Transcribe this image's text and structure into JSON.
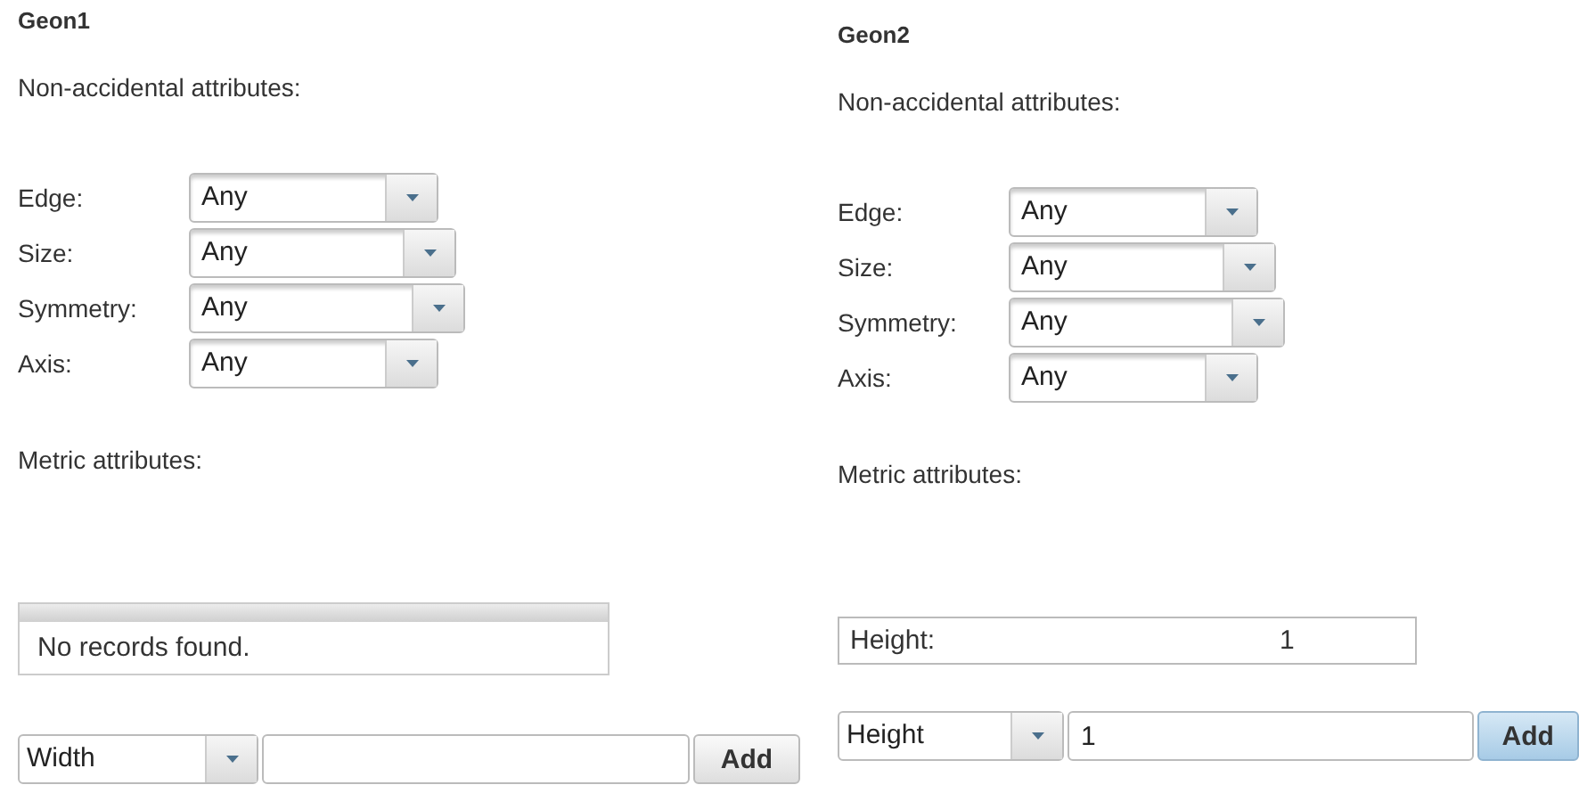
{
  "panels": [
    {
      "title": "Geon1",
      "non_accidental": {
        "heading": "Non-accidental attributes:",
        "fields": [
          {
            "label": "Edge:",
            "value": "Any"
          },
          {
            "label": "Size:",
            "value": "Any"
          },
          {
            "label": "Symmetry:",
            "value": "Any"
          },
          {
            "label": "Axis:",
            "value": "Any"
          }
        ]
      },
      "metric": {
        "heading": "Metric attributes:",
        "empty_message": "No records found."
      },
      "add_row": {
        "attribute": "Width",
        "button": {
          "label": "Add",
          "highlighted": false
        }
      }
    },
    {
      "title": "Geon2",
      "non_accidental": {
        "heading": "Non-accidental attributes:",
        "fields": [
          {
            "label": "Edge:",
            "value": "Any"
          },
          {
            "label": "Size:",
            "value": "Any"
          },
          {
            "label": "Symmetry:",
            "value": "Any"
          },
          {
            "label": "Axis:",
            "value": "Any"
          }
        ]
      },
      "metric": {
        "heading": "Metric attributes:",
        "rows": [
          {
            "label": "Height:",
            "value": "1"
          }
        ]
      },
      "add_row": {
        "attribute": "Height",
        "value": "1",
        "button": {
          "label": "Add",
          "highlighted": true
        }
      }
    }
  ]
}
